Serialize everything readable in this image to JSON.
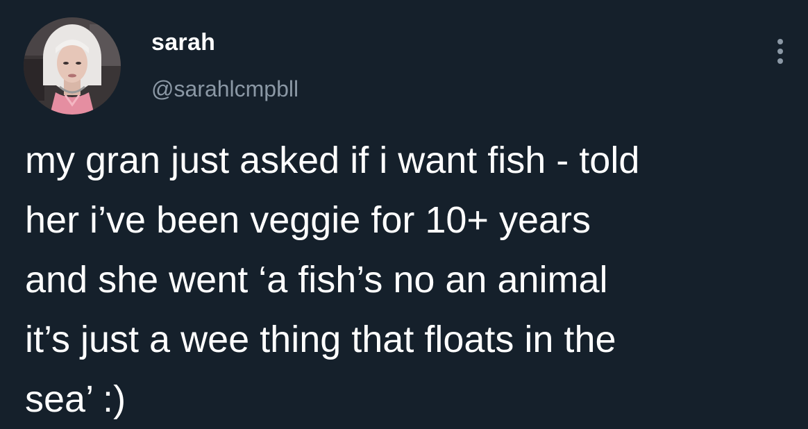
{
  "author": {
    "display_name": "sarah",
    "handle": "@sarahlcmpbll",
    "avatar_icon": "profile-photo"
  },
  "more_icon": "more-options-icon",
  "tweet": {
    "lines": [
      "my gran just asked if i want fish - told",
      "her i’ve been veggie for 10+ years",
      "and she went ‘a fish’s no an animal",
      "it’s just a wee thing that floats in the",
      "sea’ :)"
    ]
  },
  "colors": {
    "background": "#15202b",
    "text": "#ffffff",
    "secondary_text": "#8b98a5"
  }
}
